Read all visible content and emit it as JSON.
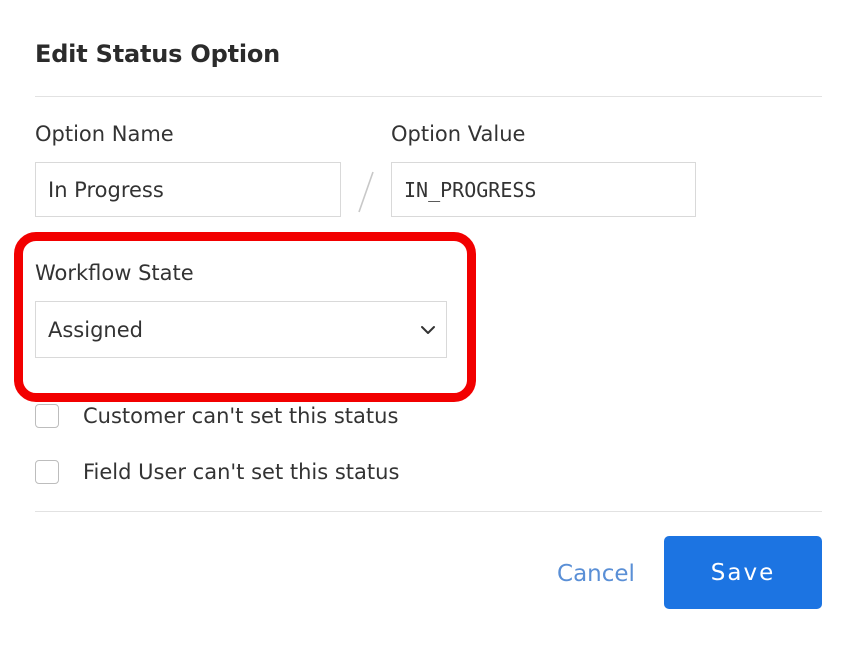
{
  "dialog": {
    "title": "Edit Status Option"
  },
  "fields": {
    "option_name": {
      "label": "Option Name",
      "value": "In Progress"
    },
    "option_value": {
      "label": "Option Value",
      "value": "IN_PROGRESS"
    },
    "workflow_state": {
      "label": "Workflow State",
      "selected": "Assigned"
    }
  },
  "checkboxes": [
    {
      "label": "Customer can't set this status",
      "checked": false
    },
    {
      "label": "Field User can't set this status",
      "checked": false
    }
  ],
  "actions": {
    "cancel_label": "Cancel",
    "save_label": "Save"
  },
  "colors": {
    "primary": "#1c74e2",
    "link": "#5a8fd6",
    "highlight": "#f20000"
  },
  "icons": {
    "separator": "slash-separator-icon",
    "dropdown": "chevron-down-icon"
  }
}
